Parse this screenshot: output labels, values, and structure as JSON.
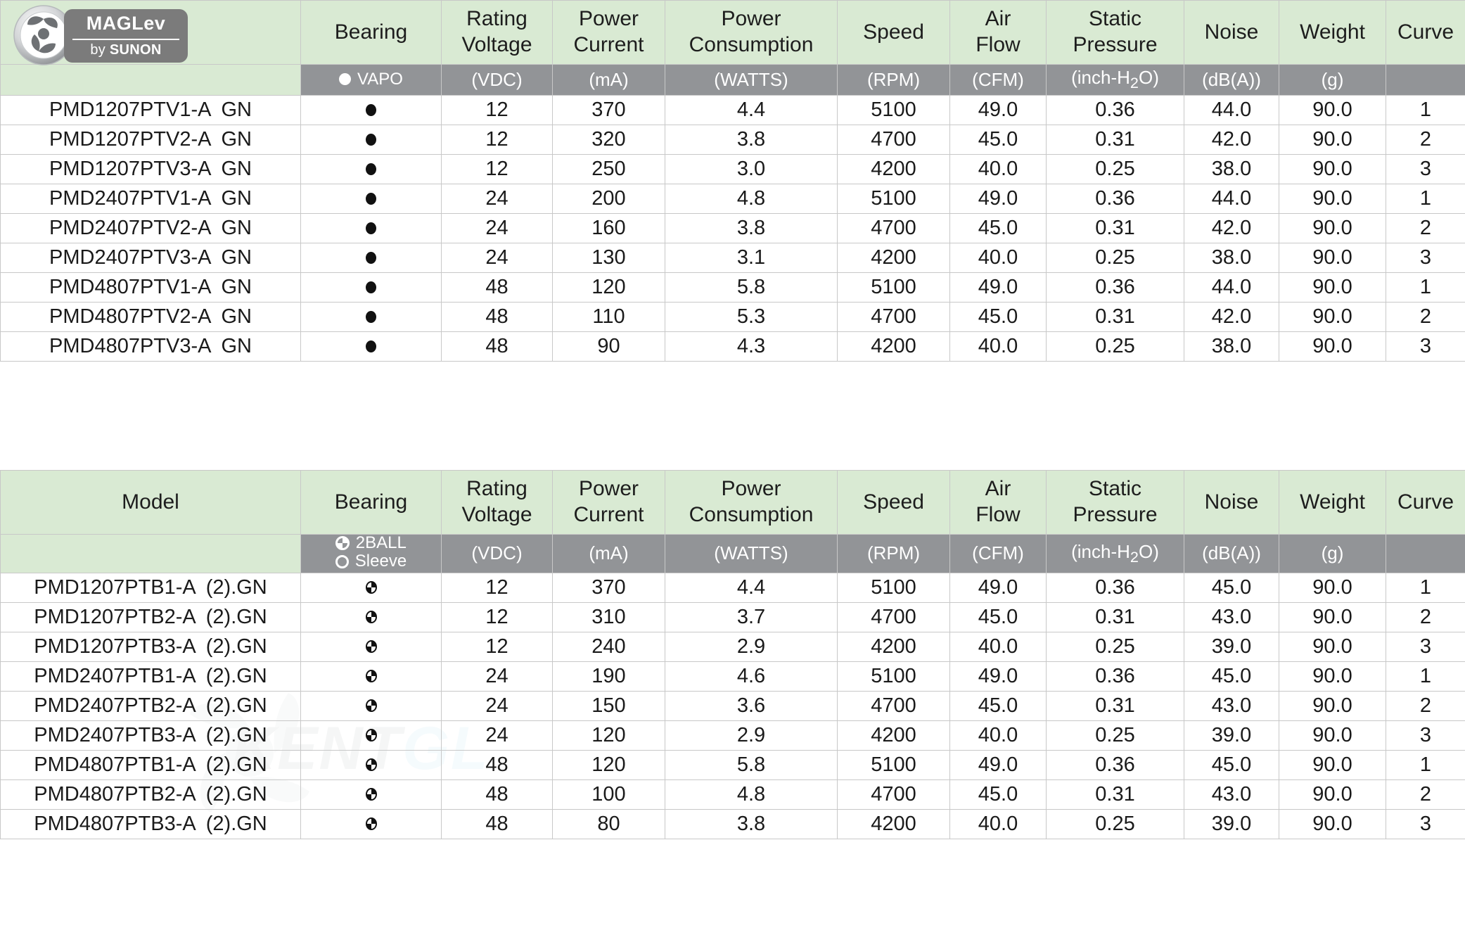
{
  "brand": {
    "logo_name": "MAGLev",
    "logo_top": "MAGLev",
    "logo_by": "by ",
    "logo_sunon": "SUNON"
  },
  "watermark": {
    "text_left": "KENT",
    "text_right": "GL"
  },
  "columns": [
    "Model",
    "Bearing",
    "Rating Voltage",
    "Power Current",
    "Power Consumption",
    "Speed",
    "Air Flow",
    "Static Pressure",
    "Noise",
    "Weight",
    "Curve"
  ],
  "headers": {
    "model": "Model",
    "bearing": "Bearing",
    "rating_l1": "Rating",
    "rating_l2": "Voltage",
    "current_l1": "Power",
    "current_l2": "Current",
    "consumption_l1": "Power",
    "consumption_l2": "Consumption",
    "speed": "Speed",
    "air_l1": "Air",
    "air_l2": "Flow",
    "sp_l1": "Static",
    "sp_l2": "Pressure",
    "noise": "Noise",
    "weight": "Weight",
    "curve": "Curve"
  },
  "units": {
    "voltage": "(VDC)",
    "current": "(mA)",
    "consumption": "(WATTS)",
    "speed": "(RPM)",
    "airflow": "(CFM)",
    "static_pressure_pre": "(inch-H",
    "static_pressure_sub": "2",
    "static_pressure_post": "O)",
    "noise": "(dB(A))",
    "weight": "(g)",
    "curve": ""
  },
  "table1": {
    "bearing_legend": [
      {
        "symbol": "filled-circle",
        "label": "VAPO"
      }
    ],
    "rows": [
      {
        "model": "PMD1207PTV1-A",
        "suffix": "GN",
        "bearing": "filled-circle",
        "voltage": "12",
        "current": "370",
        "consumption": "4.4",
        "speed": "5100",
        "airflow": "49.0",
        "static_pressure": "0.36",
        "noise": "44.0",
        "weight": "90.0",
        "curve": "1"
      },
      {
        "model": "PMD1207PTV2-A",
        "suffix": "GN",
        "bearing": "filled-circle",
        "voltage": "12",
        "current": "320",
        "consumption": "3.8",
        "speed": "4700",
        "airflow": "45.0",
        "static_pressure": "0.31",
        "noise": "42.0",
        "weight": "90.0",
        "curve": "2"
      },
      {
        "model": "PMD1207PTV3-A",
        "suffix": "GN",
        "bearing": "filled-circle",
        "voltage": "12",
        "current": "250",
        "consumption": "3.0",
        "speed": "4200",
        "airflow": "40.0",
        "static_pressure": "0.25",
        "noise": "38.0",
        "weight": "90.0",
        "curve": "3"
      },
      {
        "model": "PMD2407PTV1-A",
        "suffix": "GN",
        "bearing": "filled-circle",
        "voltage": "24",
        "current": "200",
        "consumption": "4.8",
        "speed": "5100",
        "airflow": "49.0",
        "static_pressure": "0.36",
        "noise": "44.0",
        "weight": "90.0",
        "curve": "1"
      },
      {
        "model": "PMD2407PTV2-A",
        "suffix": "GN",
        "bearing": "filled-circle",
        "voltage": "24",
        "current": "160",
        "consumption": "3.8",
        "speed": "4700",
        "airflow": "45.0",
        "static_pressure": "0.31",
        "noise": "42.0",
        "weight": "90.0",
        "curve": "2"
      },
      {
        "model": "PMD2407PTV3-A",
        "suffix": "GN",
        "bearing": "filled-circle",
        "voltage": "24",
        "current": "130",
        "consumption": "3.1",
        "speed": "4200",
        "airflow": "40.0",
        "static_pressure": "0.25",
        "noise": "38.0",
        "weight": "90.0",
        "curve": "3"
      },
      {
        "model": "PMD4807PTV1-A",
        "suffix": "GN",
        "bearing": "filled-circle",
        "voltage": "48",
        "current": "120",
        "consumption": "5.8",
        "speed": "5100",
        "airflow": "49.0",
        "static_pressure": "0.36",
        "noise": "44.0",
        "weight": "90.0",
        "curve": "1"
      },
      {
        "model": "PMD4807PTV2-A",
        "suffix": "GN",
        "bearing": "filled-circle",
        "voltage": "48",
        "current": "110",
        "consumption": "5.3",
        "speed": "4700",
        "airflow": "45.0",
        "static_pressure": "0.31",
        "noise": "42.0",
        "weight": "90.0",
        "curve": "2"
      },
      {
        "model": "PMD4807PTV3-A",
        "suffix": "GN",
        "bearing": "filled-circle",
        "voltage": "48",
        "current": "90",
        "consumption": "4.3",
        "speed": "4200",
        "airflow": "40.0",
        "static_pressure": "0.25",
        "noise": "38.0",
        "weight": "90.0",
        "curve": "3"
      }
    ]
  },
  "table2": {
    "bearing_legend": [
      {
        "symbol": "half-filled-circle",
        "label": "2BALL"
      },
      {
        "symbol": "open-circle",
        "label": "Sleeve"
      }
    ],
    "rows": [
      {
        "model": "PMD1207PTB1-A",
        "suffix": "(2).GN",
        "bearing": "half-filled-circle",
        "voltage": "12",
        "current": "370",
        "consumption": "4.4",
        "speed": "5100",
        "airflow": "49.0",
        "static_pressure": "0.36",
        "noise": "45.0",
        "weight": "90.0",
        "curve": "1"
      },
      {
        "model": "PMD1207PTB2-A",
        "suffix": "(2).GN",
        "bearing": "half-filled-circle",
        "voltage": "12",
        "current": "310",
        "consumption": "3.7",
        "speed": "4700",
        "airflow": "45.0",
        "static_pressure": "0.31",
        "noise": "43.0",
        "weight": "90.0",
        "curve": "2"
      },
      {
        "model": "PMD1207PTB3-A",
        "suffix": "(2).GN",
        "bearing": "half-filled-circle",
        "voltage": "12",
        "current": "240",
        "consumption": "2.9",
        "speed": "4200",
        "airflow": "40.0",
        "static_pressure": "0.25",
        "noise": "39.0",
        "weight": "90.0",
        "curve": "3"
      },
      {
        "model": "PMD2407PTB1-A",
        "suffix": "(2).GN",
        "bearing": "half-filled-circle",
        "voltage": "24",
        "current": "190",
        "consumption": "4.6",
        "speed": "5100",
        "airflow": "49.0",
        "static_pressure": "0.36",
        "noise": "45.0",
        "weight": "90.0",
        "curve": "1"
      },
      {
        "model": "PMD2407PTB2-A",
        "suffix": "(2).GN",
        "bearing": "half-filled-circle",
        "voltage": "24",
        "current": "150",
        "consumption": "3.6",
        "speed": "4700",
        "airflow": "45.0",
        "static_pressure": "0.31",
        "noise": "43.0",
        "weight": "90.0",
        "curve": "2"
      },
      {
        "model": "PMD2407PTB3-A",
        "suffix": "(2).GN",
        "bearing": "half-filled-circle",
        "voltage": "24",
        "current": "120",
        "consumption": "2.9",
        "speed": "4200",
        "airflow": "40.0",
        "static_pressure": "0.25",
        "noise": "39.0",
        "weight": "90.0",
        "curve": "3"
      },
      {
        "model": "PMD4807PTB1-A",
        "suffix": "(2).GN",
        "bearing": "half-filled-circle",
        "voltage": "48",
        "current": "120",
        "consumption": "5.8",
        "speed": "5100",
        "airflow": "49.0",
        "static_pressure": "0.36",
        "noise": "45.0",
        "weight": "90.0",
        "curve": "1"
      },
      {
        "model": "PMD4807PTB2-A",
        "suffix": "(2).GN",
        "bearing": "half-filled-circle",
        "voltage": "48",
        "current": "100",
        "consumption": "4.8",
        "speed": "4700",
        "airflow": "45.0",
        "static_pressure": "0.31",
        "noise": "43.0",
        "weight": "90.0",
        "curve": "2"
      },
      {
        "model": "PMD4807PTB3-A",
        "suffix": "(2).GN",
        "bearing": "half-filled-circle",
        "voltage": "48",
        "current": "80",
        "consumption": "3.8",
        "speed": "4200",
        "airflow": "40.0",
        "static_pressure": "0.25",
        "noise": "39.0",
        "weight": "90.0",
        "curve": "3"
      }
    ]
  },
  "colors": {
    "header_green": "#d9ead3",
    "units_grey": "#929497",
    "grid": "#c8c8c8",
    "text": "#1a1a1a"
  }
}
